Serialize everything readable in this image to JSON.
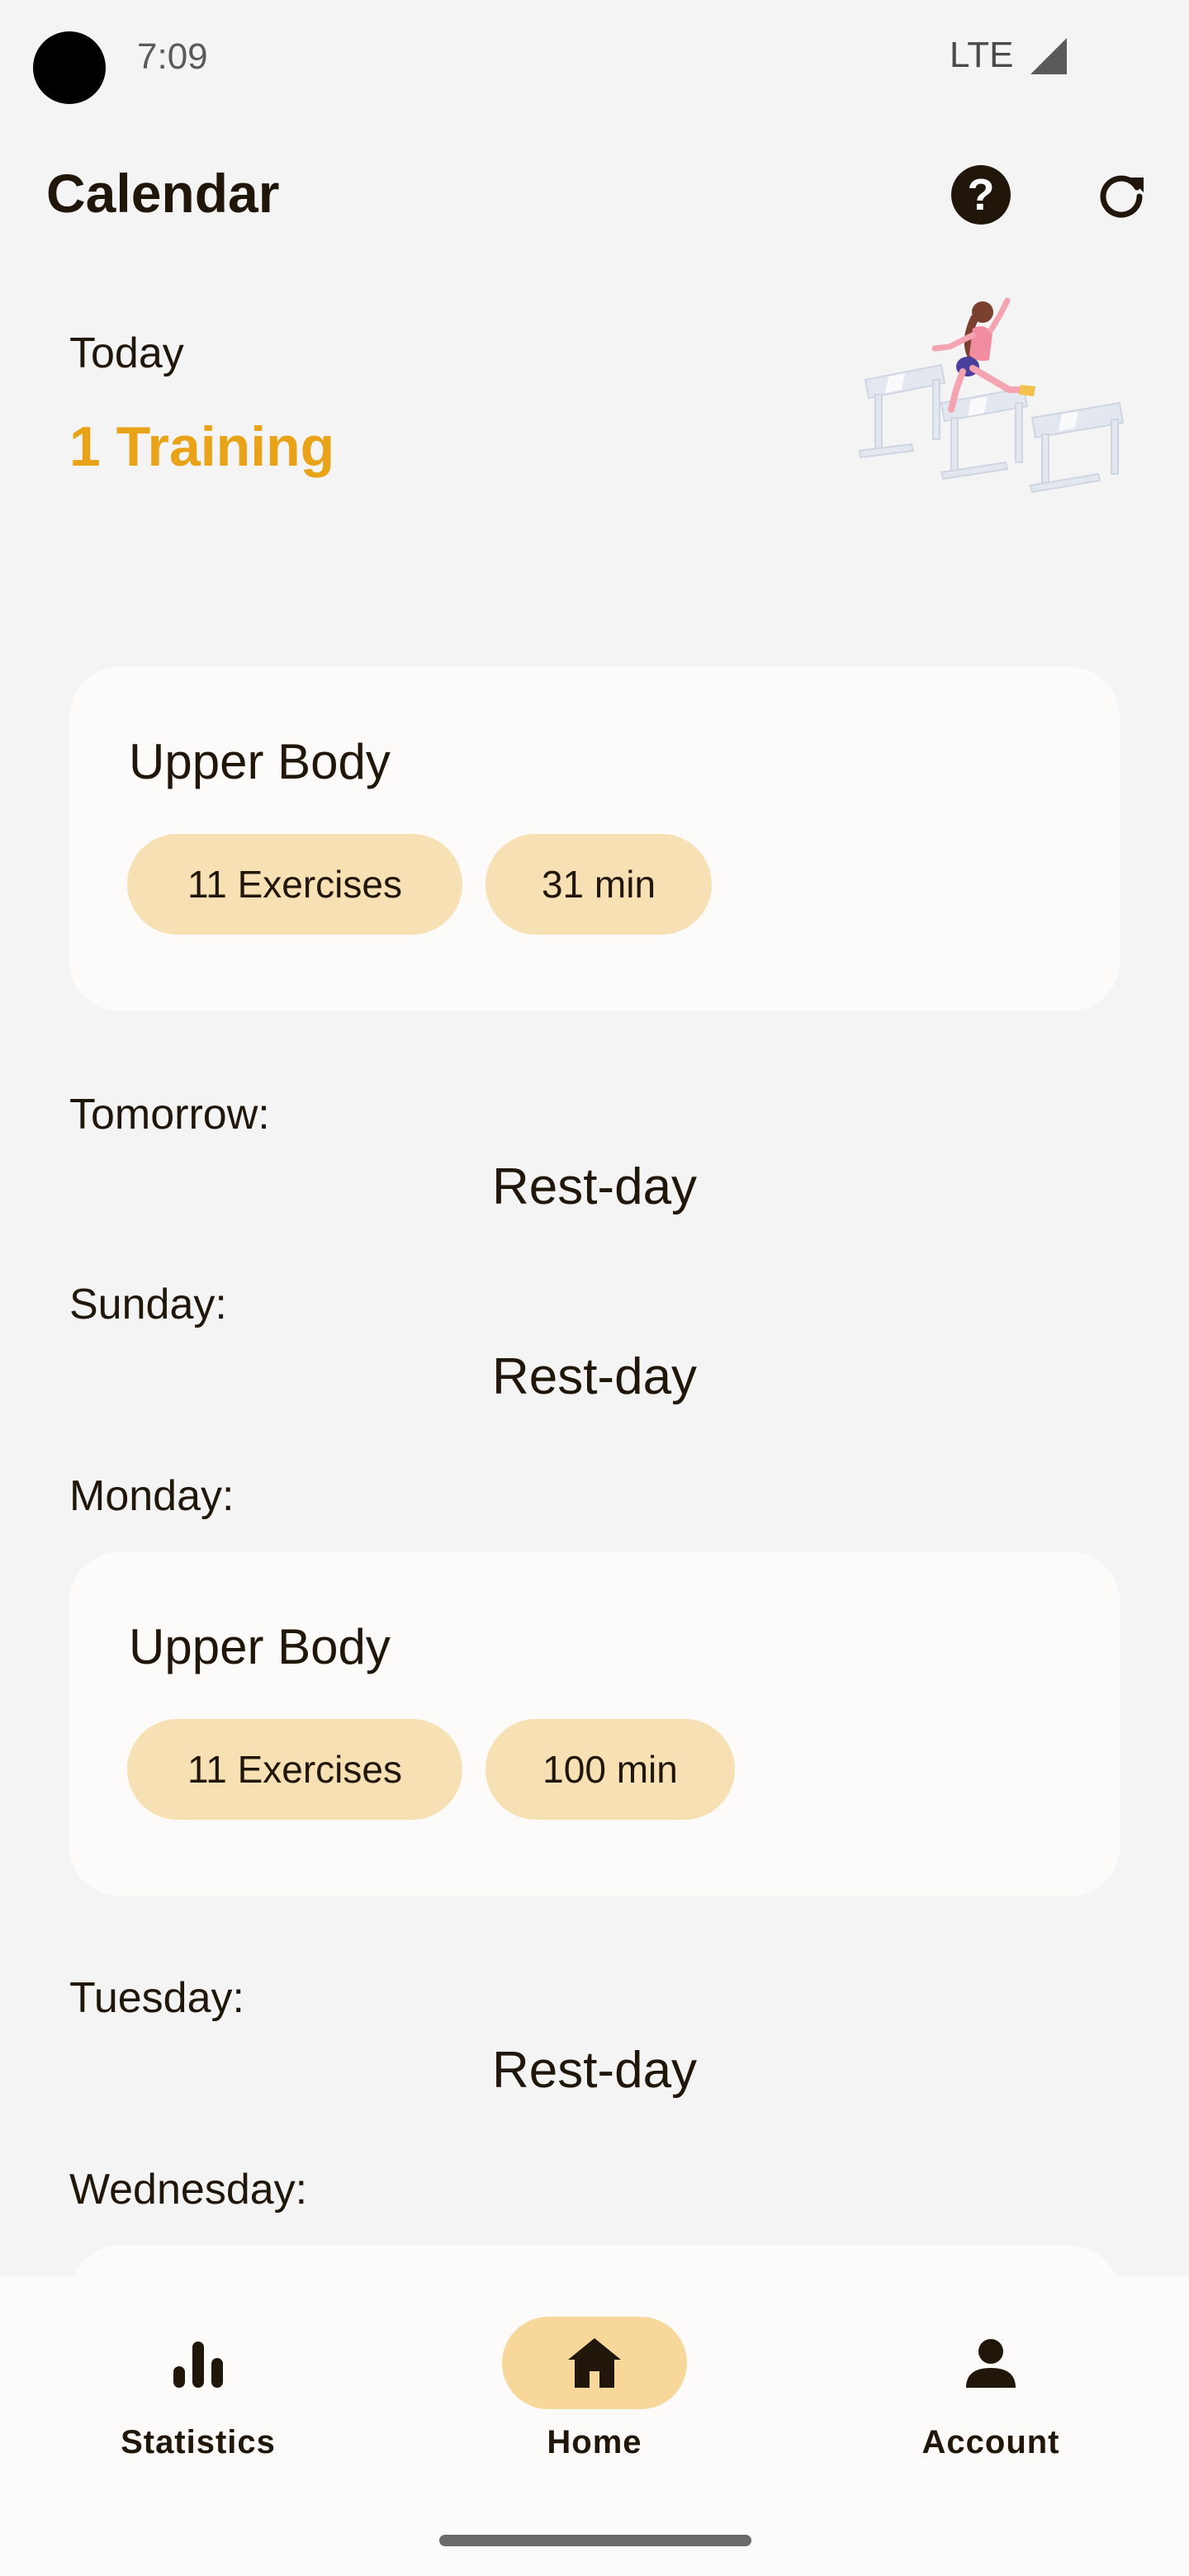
{
  "status_bar": {
    "time": "7:09",
    "network": "LTE"
  },
  "header": {
    "title": "Calendar"
  },
  "today": {
    "label": "Today",
    "count_text": "1 Training"
  },
  "days": [
    {
      "label": "",
      "card": {
        "title": "Upper Body",
        "exercises": "11 Exercises",
        "duration": "31 min"
      }
    },
    {
      "label": "Tomorrow:",
      "rest": "Rest-day"
    },
    {
      "label": "Sunday:",
      "rest": "Rest-day"
    },
    {
      "label": "Monday:",
      "card": {
        "title": "Upper Body",
        "exercises": "11 Exercises",
        "duration": "100 min"
      }
    },
    {
      "label": "Tuesday:",
      "rest": "Rest-day"
    },
    {
      "label": "Wednesday:"
    }
  ],
  "bottom_nav": {
    "items": [
      {
        "label": "Statistics",
        "icon": "bar-chart-icon",
        "active": false
      },
      {
        "label": "Home",
        "icon": "home-icon",
        "active": true
      },
      {
        "label": "Account",
        "icon": "person-icon",
        "active": false
      }
    ]
  },
  "colors": {
    "accent": "#e8a318",
    "chip": "#f7e0b4",
    "nav_active": "#f7d89a",
    "background": "#f4f4f5",
    "card": "#fcfbf9",
    "text": "#21160a"
  }
}
